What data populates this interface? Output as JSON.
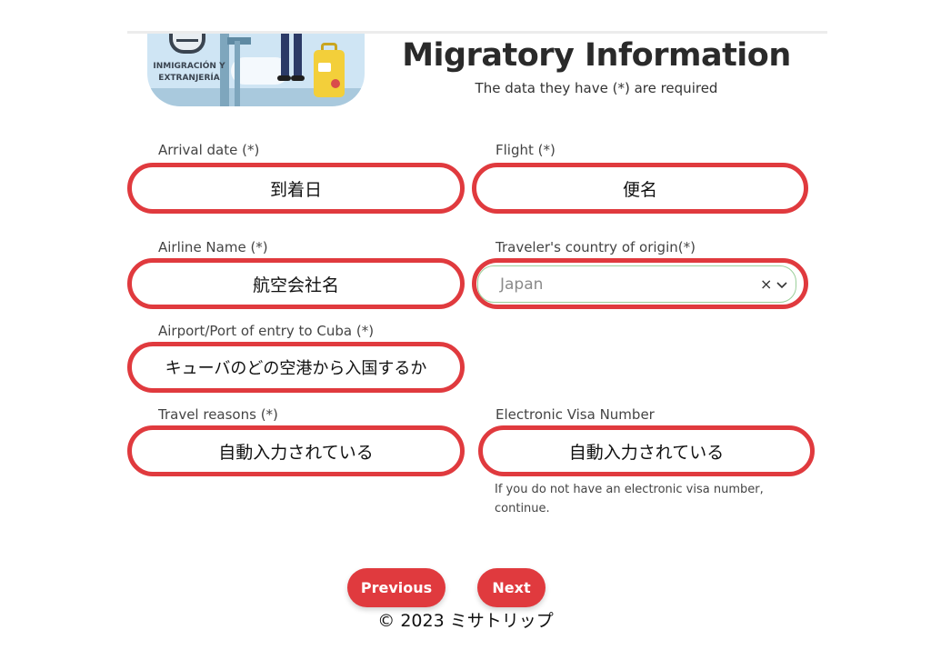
{
  "header": {
    "banner_text_line1": "INMIGRACIÓN Y",
    "banner_text_line2": "EXTRANJERÍA",
    "title": "Migratory Information",
    "subtitle": "The data they have (*) are required"
  },
  "form": {
    "arrival_date": {
      "label": "Arrival date (*)",
      "value": "到着日"
    },
    "flight": {
      "label": "Flight (*)",
      "value": "便名"
    },
    "airline_name": {
      "label": "Airline Name (*)",
      "value": "航空会社名"
    },
    "country_origin": {
      "label": "Traveler's country of origin(*)",
      "value": "Japan"
    },
    "airport_entry": {
      "label": "Airport/Port of entry to Cuba (*)",
      "value": "キューバのどの空港から入国するか"
    },
    "travel_reasons": {
      "label": "Travel reasons (*)",
      "value": "自動入力されている"
    },
    "evisa_number": {
      "label": "Electronic Visa Number",
      "value": "自動入力されている",
      "hint": "If you do not have an electronic visa number, continue."
    }
  },
  "buttons": {
    "previous": "Previous",
    "next": "Next"
  },
  "footer": {
    "copyright": "© 2023 ミサトリップ"
  },
  "colors": {
    "accent": "#e03a3e",
    "select_border": "#9bcf9b"
  }
}
